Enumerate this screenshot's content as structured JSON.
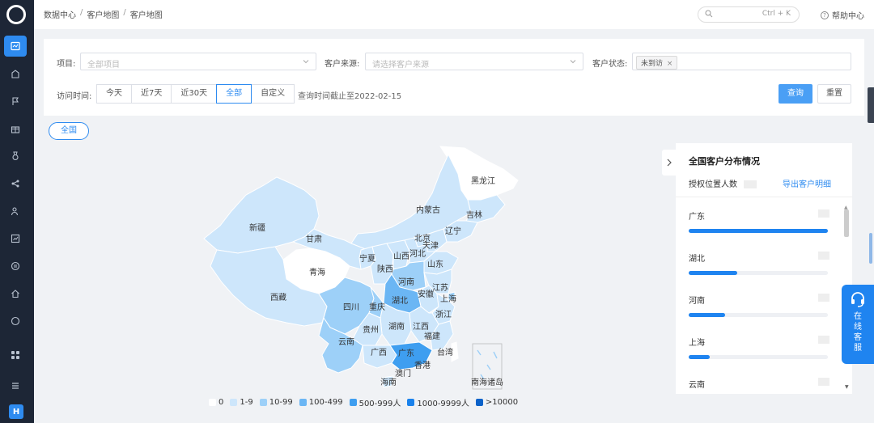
{
  "breadcrumb": [
    "数据中心",
    "客户地图",
    "客户地图"
  ],
  "topbar": {
    "search_shortcut": "Ctrl + K",
    "help_label": "帮助中心"
  },
  "filter": {
    "project_label": "项目:",
    "project_placeholder": "全部项目",
    "source_label": "客户来源:",
    "source_placeholder": "请选择客户来源",
    "status_label": "客户状态:",
    "status_tag": "未到访",
    "time_label": "访问时间:",
    "time_tabs": [
      "今天",
      "近7天",
      "近30天",
      "全部",
      "自定义"
    ],
    "active_tab": "全部",
    "range_note": "查询时间截止至2022-02-15",
    "query_button": "查询",
    "reset_button": "重置"
  },
  "map": {
    "scope_pill": "全国",
    "provinces": [
      "黑龙江",
      "吉林",
      "辽宁",
      "内蒙古",
      "北京",
      "天津",
      "河北",
      "山东",
      "山西",
      "新疆",
      "甘肃",
      "宁夏",
      "青海",
      "陕西",
      "河南",
      "江苏",
      "上海",
      "安徽",
      "湖北",
      "西藏",
      "四川",
      "重庆",
      "浙江",
      "江西",
      "湖南",
      "贵州",
      "福建",
      "云南",
      "广西",
      "广东",
      "台湾",
      "香港",
      "澳门",
      "海南",
      "南海诸岛"
    ],
    "legend": [
      {
        "label": "0",
        "color": "#ffffff"
      },
      {
        "label": "1-9",
        "color": "#cde6fb"
      },
      {
        "label": "10-99",
        "color": "#9dd0f8"
      },
      {
        "label": "100-499",
        "color": "#6bb6f4"
      },
      {
        "label": "500-999人",
        "color": "#3e9ef0"
      },
      {
        "label": "1000-9999人",
        "color": "#1a82ec"
      },
      {
        "label": ">10000",
        "color": "#0b62c9"
      }
    ]
  },
  "panel": {
    "title": "全国客户分布情况",
    "sub_label": "授权位置人数",
    "export_link": "导出客户明细",
    "ranking": [
      {
        "name": "广东",
        "ratio": 1.0
      },
      {
        "name": "湖北",
        "ratio": 0.35
      },
      {
        "name": "河南",
        "ratio": 0.26
      },
      {
        "name": "上海",
        "ratio": 0.15
      },
      {
        "name": "云南",
        "ratio": 0.0
      }
    ]
  },
  "service": {
    "label": "在线客服"
  },
  "user": {
    "initial": "H"
  },
  "colors": {
    "accent": "#2e8bf0",
    "sidebar": "#1d2636"
  }
}
